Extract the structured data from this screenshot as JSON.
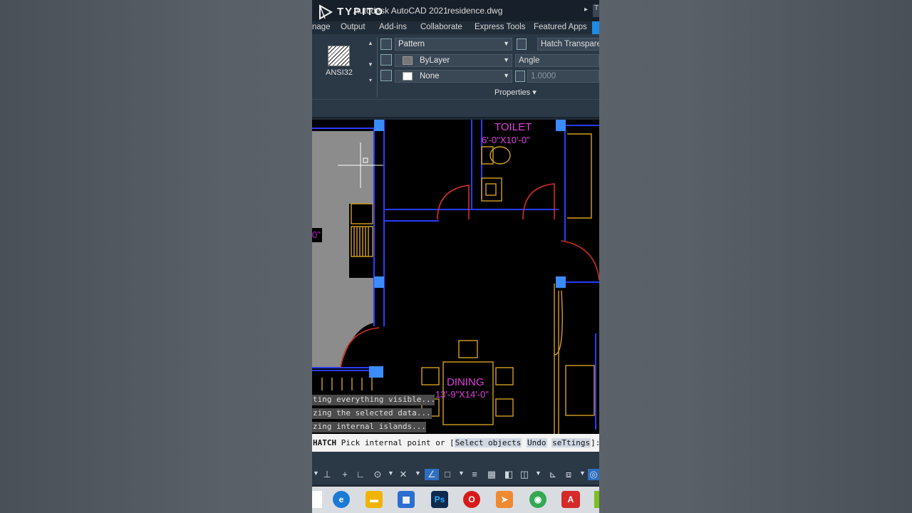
{
  "watermark": "TYPITO",
  "window": {
    "app_title": "Autodesk AutoCAD 2021",
    "file_name": "residence.dwg",
    "cut_label": "T"
  },
  "ribbon_tabs": [
    "nage",
    "Output",
    "Add-ins",
    "Collaborate",
    "Express Tools",
    "Featured Apps"
  ],
  "ribbon": {
    "pattern_name": "ANSI32",
    "hatch_type": "Pattern",
    "hatch_color": "ByLayer",
    "background_color": "None",
    "transparency_label": "Hatch Transparen",
    "angle_label": "Angle",
    "scale_value": "1.0000",
    "panel_title": "Properties"
  },
  "drawing": {
    "rooms": [
      {
        "name": "TOILET",
        "size": "6'-0\"X10'-0\""
      },
      {
        "name": "DINING",
        "size": "13'-9\"X14'-0\""
      }
    ],
    "partial_label": "0\""
  },
  "messages": [
    "ting everything visible...",
    "zing the selected data...",
    "zing internal islands..."
  ],
  "command": {
    "name": "HATCH",
    "prompt": "Pick internal point or [",
    "options": [
      "Select objects",
      "Undo",
      "seTtings"
    ],
    "suffix": "]:"
  },
  "colors": {
    "grip": "#3a8cff",
    "room_label": "#e040e0",
    "fixture": "#d4a020",
    "door": "#d43020",
    "wall": "#2a3cff",
    "hatch_fill": "#8c8c8c"
  }
}
